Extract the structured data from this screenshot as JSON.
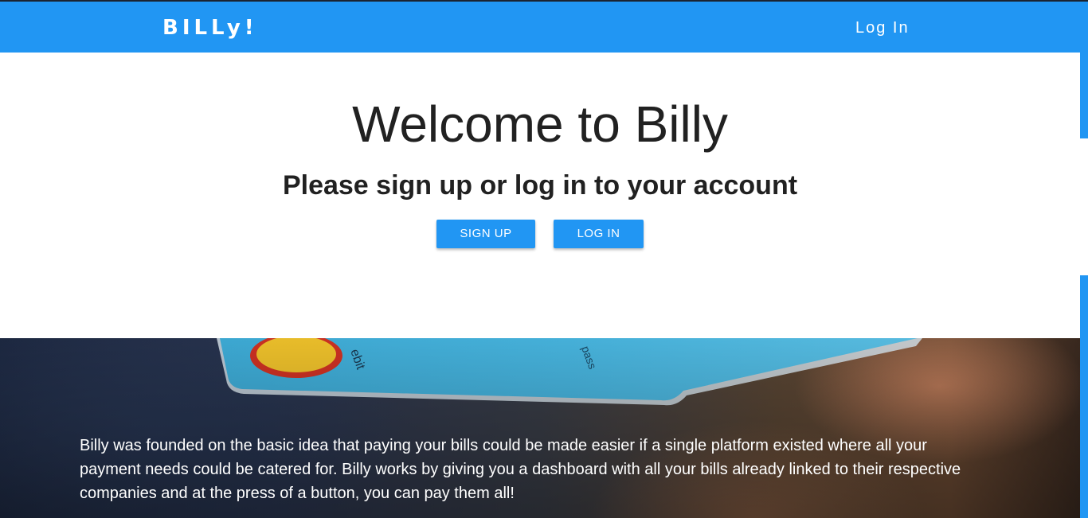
{
  "navbar": {
    "brand": "BILLy!",
    "login_link": "Log In"
  },
  "hero": {
    "title": "Welcome to Billy",
    "subtitle": "Please sign up or log in to your account",
    "signup_button": "SIGN UP",
    "login_button": "LOG IN"
  },
  "about": {
    "text": "Billy was founded on the basic idea that paying your bills could be made easier if a single platform existed where all your payment needs could be catered for. Billy works by giving you a dashboard with all your bills already linked to their respective companies and at the press of a button, you can pay them all!"
  },
  "colors": {
    "primary": "#2196f3",
    "text_dark": "#212121",
    "white": "#ffffff"
  }
}
